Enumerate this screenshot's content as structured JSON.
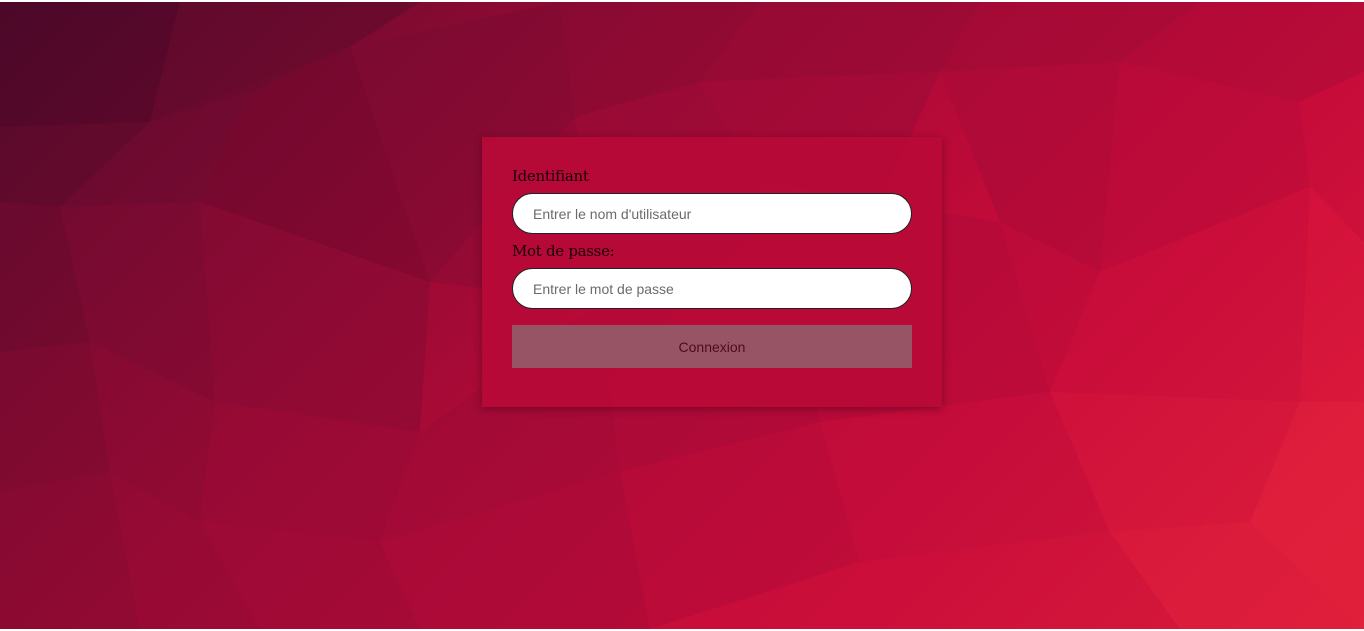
{
  "login": {
    "username_label": "Identifiant",
    "username_placeholder": "Entrer le nom d'utilisateur",
    "username_value": "",
    "password_label": "Mot de passe:",
    "password_placeholder": "Entrer le mot de passe",
    "password_value": "",
    "submit_label": "Connexion"
  },
  "colors": {
    "card_background": "#b90a37",
    "button_background": "#975464",
    "button_text": "#4a0c1c",
    "background_dark": "#4f0a2a",
    "background_light": "#e8283a"
  }
}
